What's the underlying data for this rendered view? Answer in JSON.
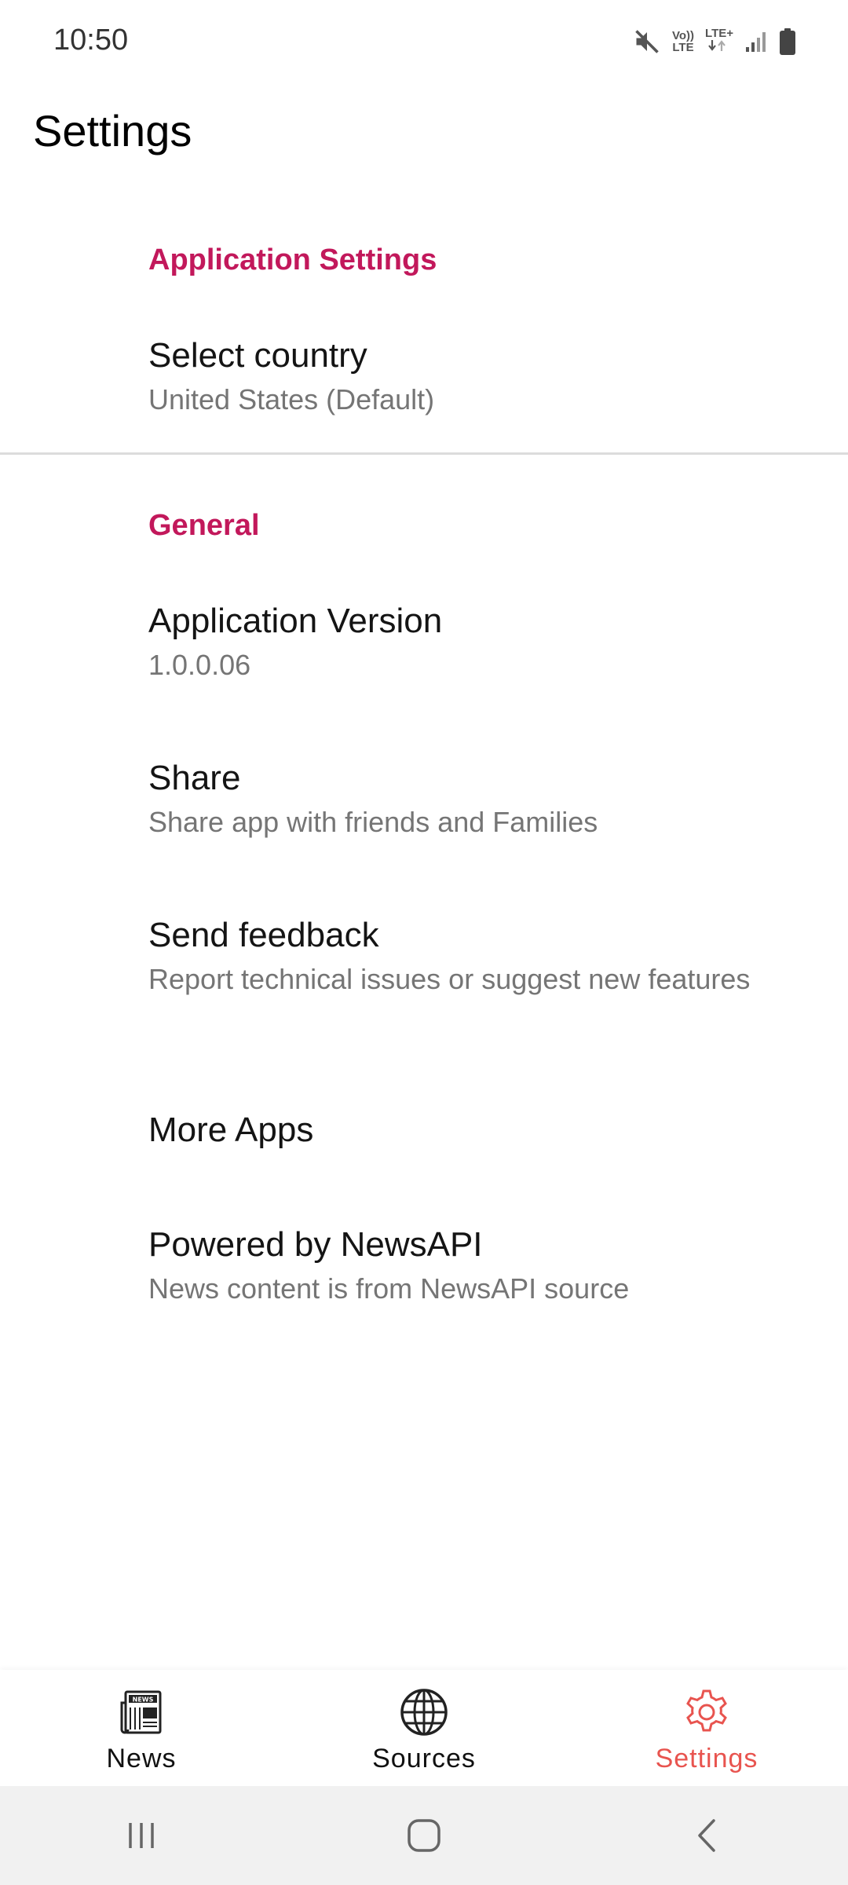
{
  "status_bar": {
    "time": "10:50",
    "icons": [
      "mute-icon",
      "volte-icon",
      "lte-plus-icon",
      "signal-icon",
      "battery-icon"
    ],
    "volte_line1": "Vo))",
    "volte_line2": "LTE",
    "lte_plus": "LTE+"
  },
  "header": {
    "title": "Settings"
  },
  "sections": {
    "application": {
      "header": "Application Settings",
      "select_country": {
        "title": "Select country",
        "summary": "United States (Default)"
      }
    },
    "general": {
      "header": "General",
      "version": {
        "title": "Application Version",
        "summary": "1.0.0.06"
      },
      "share": {
        "title": "Share",
        "summary": "Share app with friends and Families"
      },
      "feedback": {
        "title": "Send feedback",
        "summary": "Report technical issues or suggest new features"
      },
      "more_apps": {
        "title": "More Apps"
      },
      "powered_by": {
        "title": "Powered by NewsAPI",
        "summary": "News content is from NewsAPI source"
      }
    }
  },
  "bottom_nav": {
    "items": [
      {
        "label": "News",
        "icon": "newspaper-icon",
        "active": false
      },
      {
        "label": "Sources",
        "icon": "globe-icon",
        "active": false
      },
      {
        "label": "Settings",
        "icon": "gear-icon",
        "active": true
      }
    ],
    "active_color": "#e8544f"
  },
  "colors": {
    "accent": "#c2185b",
    "summary_text": "#757575"
  },
  "system_nav": [
    "recents-icon",
    "home-icon",
    "back-icon"
  ]
}
